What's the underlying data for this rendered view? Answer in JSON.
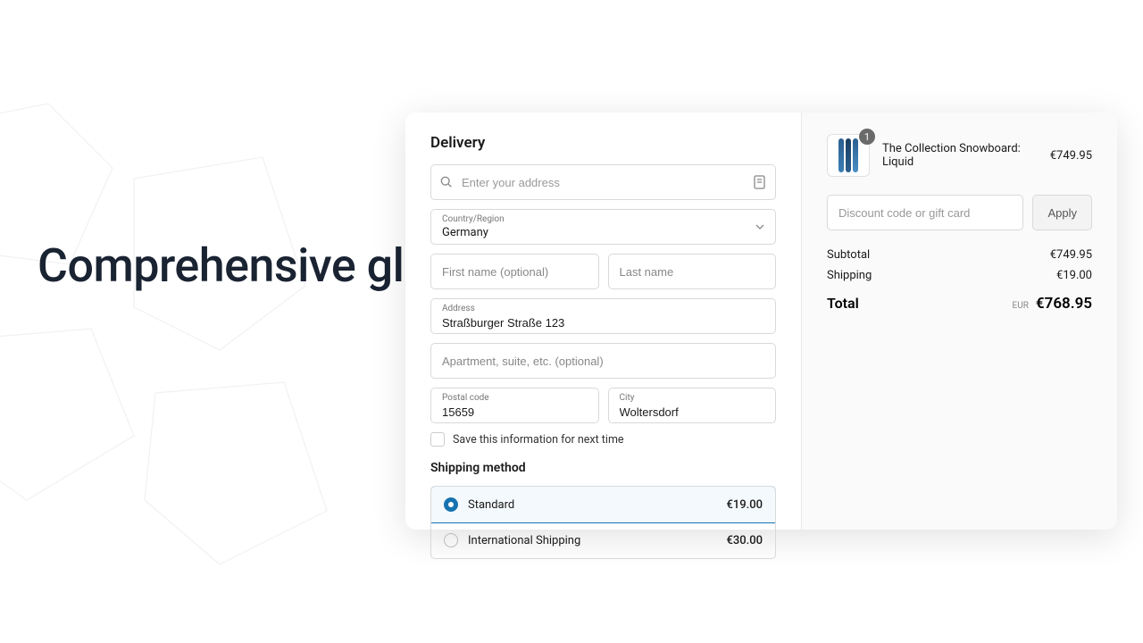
{
  "headline": "Comprehensive global address database",
  "delivery": {
    "title": "Delivery",
    "search_placeholder": "Enter your address",
    "country_label": "Country/Region",
    "country_value": "Germany",
    "first_name_placeholder": "First name (optional)",
    "last_name_placeholder": "Last name",
    "address_label": "Address",
    "address_value": "Straßburger Straße 123",
    "apt_placeholder": "Apartment, suite, etc. (optional)",
    "postal_label": "Postal code",
    "postal_value": "15659",
    "city_label": "City",
    "city_value": "Woltersdorf",
    "save_label": "Save this information for next time"
  },
  "shipping": {
    "title": "Shipping method",
    "options": [
      {
        "name": "Standard",
        "price": "€19.00",
        "selected": true
      },
      {
        "name": "International Shipping",
        "price": "€30.00",
        "selected": false
      }
    ]
  },
  "cart": {
    "product_name": "The Collection Snowboard: Liquid",
    "product_price": "€749.95",
    "qty": "1",
    "discount_placeholder": "Discount code or gift card",
    "apply_label": "Apply",
    "subtotal_label": "Subtotal",
    "subtotal_value": "€749.95",
    "shipping_label": "Shipping",
    "shipping_value": "€19.00",
    "total_label": "Total",
    "currency": "EUR",
    "total_value": "€768.95"
  }
}
